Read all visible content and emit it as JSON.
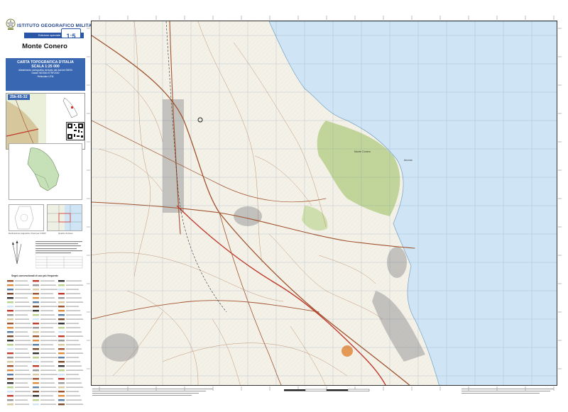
{
  "institute": {
    "name": "ISTITUTO GEOGRAFICO MILITARE",
    "edition_label": "Edizione speciale",
    "edition_badge": "1:5"
  },
  "sheet": {
    "title": "Monte Conero",
    "series_line1": "CARTA TOPOGRAFICA D'ITALIA",
    "series_line2": "SCALA 1:25 000",
    "series_small": [
      "Allestimento cartografico derivato dai dati del DBSN",
      "Datum WGS84 ETRF2000",
      "Reticolato UTM"
    ],
    "code": "25k-65-32"
  },
  "captions": {
    "declination": "Declinazione magnetica: Ovest per il 2023",
    "grid_note": "Quadro d'unione",
    "legend_title": "Segni convenzionali di uso più frequente"
  },
  "map_labels": {
    "headland": "Monte Conero",
    "scala": "Ancona"
  },
  "colors": {
    "sea": "#cfe5f5",
    "land": "#f4f1e8",
    "forest": "#b7d08c",
    "road": "#a0522d",
    "highway": "#c0392b",
    "urban": "#9a9a9a",
    "brand_blue": "#2a56a8"
  }
}
